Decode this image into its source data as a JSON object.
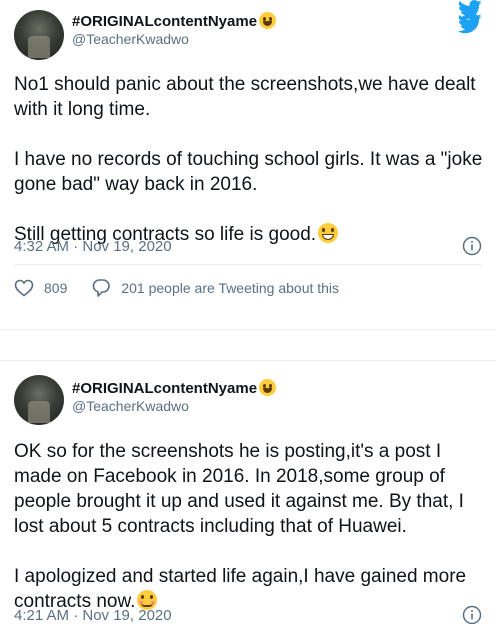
{
  "tweets": [
    {
      "display_name": "#ORIGINALcontentNyame",
      "name_emoji": "winking-tongue-emoji",
      "handle": "@TeacherKwadwo",
      "paragraphs": [
        "No1 should panic about the screenshots,we have dealt with it long time.",
        "I have no records of touching school girls. It was a \"joke gone bad\" way back in 2016.",
        "Still getting contracts so life is good."
      ],
      "end_emoji": "grinning-squinting-emoji",
      "timestamp": "4:32 AM · Nov 19, 2020",
      "likes": "809",
      "retweet_text": "201 people are Tweeting about this"
    },
    {
      "display_name": "#ORIGINALcontentNyame",
      "name_emoji": "winking-tongue-emoji",
      "handle": "@TeacherKwadwo",
      "paragraphs": [
        "OK so for the screenshots he is posting,it's a post I made on Facebook in 2016. In 2018,some group of people brought it up and used it against me. By that, I lost about 5 contracts including that of Huawei.",
        "I apologized and started life again,I have gained more contracts now."
      ],
      "end_emoji": "smiling-eyes-emoji",
      "timestamp": "4:21 AM · Nov 19, 2020"
    }
  ],
  "colors": {
    "twitter_blue": "#1da1f2",
    "text_primary": "#0f1419",
    "text_secondary": "#5b7083",
    "divider": "#e6ecf0"
  }
}
